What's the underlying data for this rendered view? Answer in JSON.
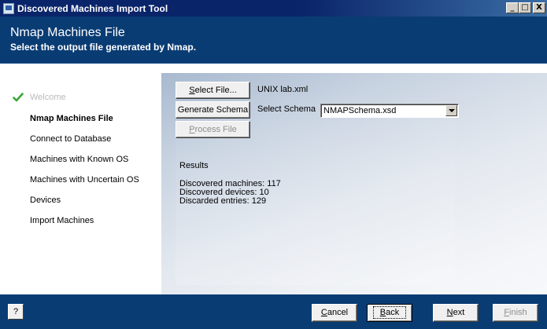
{
  "window": {
    "title": "Discovered Machines Import Tool",
    "controls": {
      "minimize": "_",
      "maximize": "□",
      "close": "X"
    }
  },
  "header": {
    "title": "Nmap Machines File",
    "subtitle": "Select the output file generated by Nmap."
  },
  "nav": {
    "items": [
      {
        "label": "Welcome",
        "state": "done"
      },
      {
        "label": "Nmap Machines File",
        "state": "active"
      },
      {
        "label": "Connect to Database",
        "state": "pending"
      },
      {
        "label": "Machines with Known OS",
        "state": "pending"
      },
      {
        "label": "Machines with Uncertain OS",
        "state": "pending"
      },
      {
        "label": "Devices",
        "state": "pending"
      },
      {
        "label": "Import Machines",
        "state": "pending"
      }
    ]
  },
  "content": {
    "select_file_label": "Select File...",
    "select_file_mnemonic": "S",
    "select_file_rest": "elect File...",
    "file_name": "UNIX lab.xml",
    "generate_schema_label": "Generate Schema",
    "select_schema_label": "Select Schema",
    "schema_value": "NMAPSchema.xsd",
    "process_file_mnemonic": "P",
    "process_file_rest": "rocess File",
    "results_heading": "Results",
    "results_lines": [
      "Discovered machines: 117",
      "Discovered devices: 10",
      "Discarded entries: 129"
    ]
  },
  "footer": {
    "help_label": "?",
    "cancel_mnemonic": "C",
    "cancel_rest": "ancel",
    "back_mnemonic": "B",
    "back_rest": "ack",
    "next_mnemonic": "N",
    "next_rest": "ext",
    "finish_mnemonic": "F",
    "finish_rest": "inish"
  },
  "colors": {
    "header_bg": "#0a3c74",
    "titlebar_bg": "#0a246a",
    "check_green": "#3aa63a",
    "disabled_text": "#8d8d8d"
  },
  "icons": {
    "app": "app-window-icon",
    "check": "checkmark-icon",
    "dropdown": "chevron-down-icon"
  }
}
